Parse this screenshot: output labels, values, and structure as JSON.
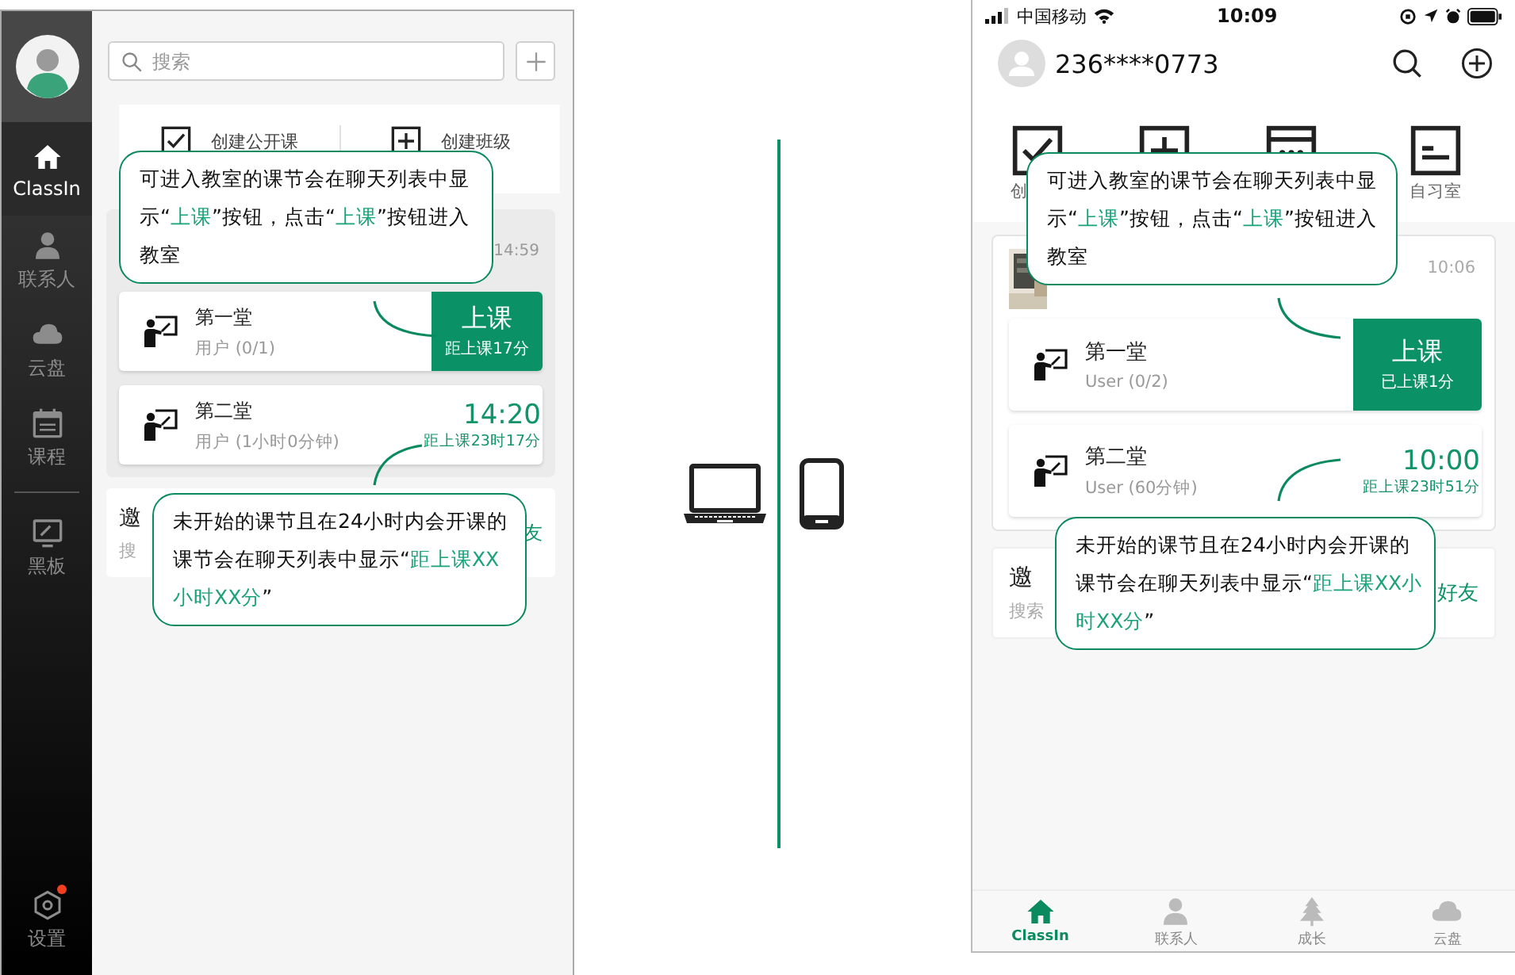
{
  "desktop": {
    "sidebar": {
      "items": [
        {
          "kind": "home",
          "label": "ClassIn",
          "selected": true
        },
        {
          "kind": "person",
          "label": "联系人",
          "selected": false
        },
        {
          "kind": "cloud",
          "label": "云盘",
          "selected": false
        },
        {
          "kind": "calendar",
          "label": "课程",
          "selected": false
        },
        {
          "kind": "board",
          "label": "黑板",
          "selected": false
        }
      ],
      "settings": {
        "label": "设置",
        "badge": true
      }
    },
    "search": {
      "placeholder": "搜索"
    },
    "quick_actions": [
      {
        "kind": "check",
        "label": "创建公开课"
      },
      {
        "kind": "plus",
        "label": "创建班级"
      }
    ],
    "group": {
      "time": "14:59",
      "lessons": [
        {
          "kind": "live",
          "title": "第一堂",
          "subtitle": "用户 (0/1)",
          "button": "上课",
          "note": "距上课17分"
        },
        {
          "kind": "upcoming",
          "title": "第二堂",
          "subtitle": "用户 (1小时0分钟)",
          "time": "14:20",
          "note": "距上课23时17分"
        }
      ]
    },
    "invite": {
      "title": "邀",
      "subtitle": "搜",
      "action": "友"
    },
    "callouts": [
      {
        "segments": [
          {
            "text": "可进入教室的课节会在聊天列表中显示“",
            "highlight": false
          },
          {
            "text": "上课",
            "highlight": true
          },
          {
            "text": "”按钮，点击“",
            "highlight": false
          },
          {
            "text": "上课",
            "highlight": true
          },
          {
            "text": "”按钮进入教室",
            "highlight": false
          }
        ]
      },
      {
        "segments": [
          {
            "text": "未开始的课节且在24小时内会开课的课节会在聊天列表中显示“",
            "highlight": false
          },
          {
            "text": "距上课XX小时XX分",
            "highlight": true
          },
          {
            "text": "”",
            "highlight": false
          }
        ]
      }
    ]
  },
  "mobile": {
    "status_bar": {
      "carrier": "中国移动",
      "time": "10:09"
    },
    "header": {
      "account": "236****0773"
    },
    "quick_actions": [
      {
        "kind": "check",
        "label": "创"
      },
      {
        "kind": "plus"
      },
      {
        "kind": "calendar"
      },
      {
        "kind": "note",
        "label": "自习室"
      }
    ],
    "group": {
      "time": "10:06",
      "lessons": [
        {
          "kind": "live",
          "title": "第一堂",
          "subtitle": "User (0/2)",
          "button": "上课",
          "note": "已上课1分"
        },
        {
          "kind": "upcoming",
          "title": "第二堂",
          "subtitle": "User (60分钟)",
          "time": "10:00",
          "note": "距上课23时51分"
        }
      ]
    },
    "invite": {
      "title": "邀",
      "subtitle": "搜索",
      "action": "好友"
    },
    "callouts": [
      {
        "segments": [
          {
            "text": "可进入教室的课节会在聊天列表中显示“",
            "highlight": false
          },
          {
            "text": "上课",
            "highlight": true
          },
          {
            "text": "”按钮，点击“",
            "highlight": false
          },
          {
            "text": "上课",
            "highlight": true
          },
          {
            "text": "”按钮进入教室",
            "highlight": false
          }
        ]
      },
      {
        "segments": [
          {
            "text": "未开始的课节且在24小时内会开课的课节会在聊天列表中显示“",
            "highlight": false
          },
          {
            "text": "距上课XX小时XX分",
            "highlight": true
          },
          {
            "text": "”",
            "highlight": false
          }
        ]
      }
    ],
    "tabs": [
      {
        "kind": "home",
        "label": "ClassIn",
        "selected": true
      },
      {
        "kind": "person",
        "label": "联系人",
        "selected": false
      },
      {
        "kind": "tree",
        "label": "成长",
        "selected": false
      },
      {
        "kind": "cloud",
        "label": "云盘",
        "selected": false
      }
    ]
  }
}
